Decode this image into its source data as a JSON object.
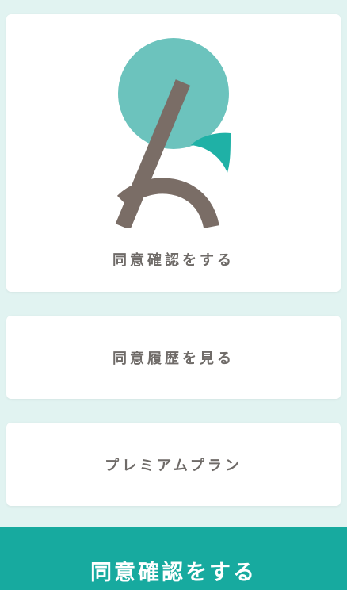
{
  "menu": {
    "consent_label": "同意確認をする",
    "history_label": "同意履歴を見る",
    "premium_label": "プレミアムプラン"
  },
  "cta": {
    "label": "同意確認をする"
  },
  "colors": {
    "background": "#e1f3f1",
    "card": "#ffffff",
    "logo_circle": "#6cc3bd",
    "logo_leaf": "#1fb1a6",
    "logo_stroke": "#7a6d66",
    "cta": "#17aa9f",
    "label_text": "#6f6b68"
  },
  "icons": {
    "logo": "hiragana-ko-logo-icon"
  }
}
